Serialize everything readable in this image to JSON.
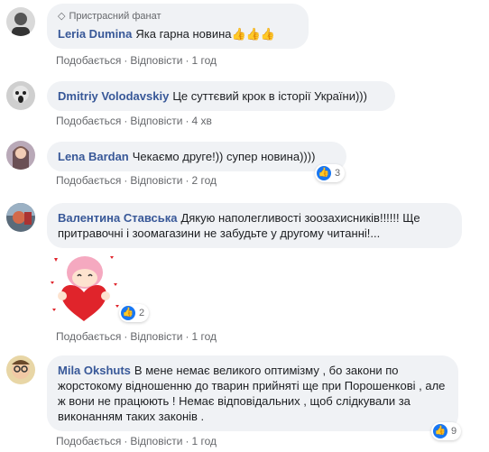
{
  "comments": [
    {
      "badge": "Пристрасний фанат",
      "author": "Leria Dumina",
      "text": "Яка гарна новина👍👍👍",
      "like": "Подобається",
      "reply": "Відповісти",
      "time": "1 год"
    },
    {
      "author": "Dmitriy Volodavskiy",
      "text": "Це суттєвий крок в історії України)))",
      "like": "Подобається",
      "reply": "Відповісти",
      "time": "4 хв"
    },
    {
      "author": "Lena Bardan",
      "text": "Чекаємо друге!)) супер новина))))",
      "like": "Подобається",
      "reply": "Відповісти",
      "time": "2 год",
      "reaction_count": "3"
    },
    {
      "author": "Валентина Ставська",
      "text": "Дякую наполегливості зоозахисників!!!!!! Ще притравочні і зоомагазини не забудьте у другому читанні!...",
      "like": "Подобається",
      "reply": "Відповісти",
      "time": "1 год",
      "reaction_count": "2"
    },
    {
      "author": "Mila Okshuts",
      "text": "В мене немає великого оптимізму , бо закони по жорстокому відношенню до тварин прийняті ще при Порошенкові , але ж вони не працюють ! Немає відповідальних , щоб слідкували за виконанням таких законів .",
      "like": "Подобається",
      "reply": "Відповісти",
      "time": "1 год",
      "reaction_count": "9"
    }
  ],
  "separator": "·",
  "colors": {
    "author": "#385898",
    "bubble": "#f0f2f5",
    "meta": "#65676b",
    "like_blue": "#1877f2",
    "sticker_heart": "#e0242b"
  },
  "icons": [
    "diamond-icon",
    "like-icon",
    "heart-sticker"
  ]
}
